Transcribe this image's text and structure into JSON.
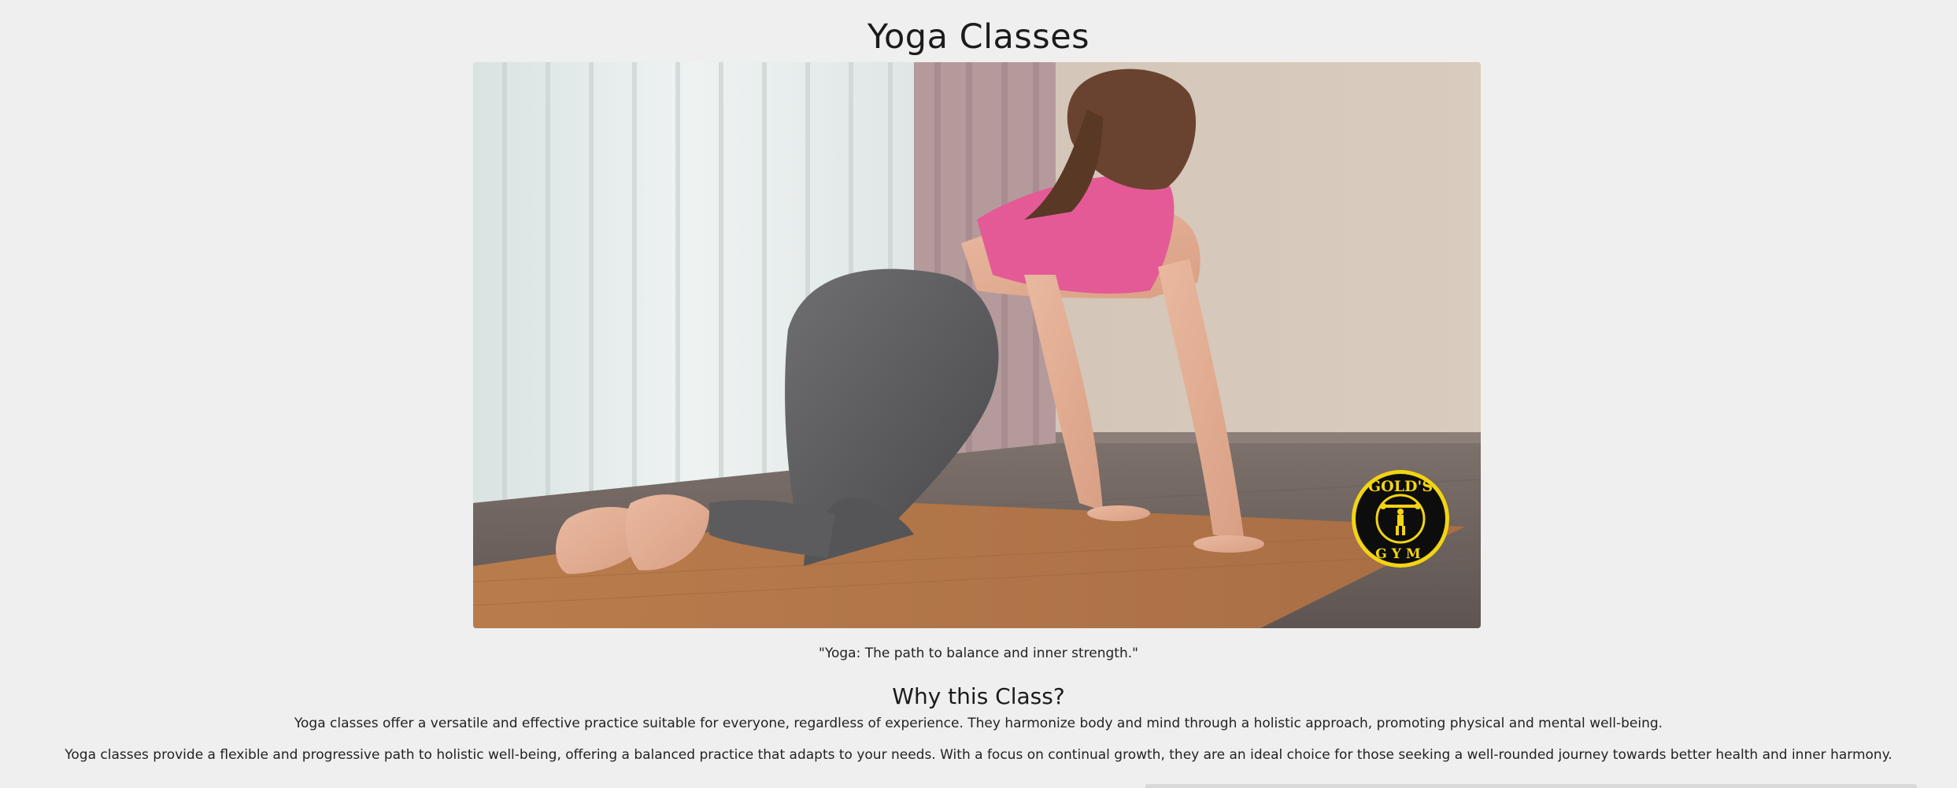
{
  "page": {
    "title": "Yoga Classes",
    "quote": "\"Yoga: The path to balance and inner strength.\"",
    "section_title": "Why this Class?",
    "paragraphs": [
      "Yoga classes offer a versatile and effective practice suitable for everyone, regardless of experience. They harmonize body and mind through a holistic approach, promoting physical and mental well-being.",
      "Yoga classes provide a flexible and progressive path to holistic well-being, offering a balanced practice that adapts to your needs. With a focus on continual growth, they are an ideal choice for those seeking a well-rounded journey towards better health and inner harmony."
    ]
  },
  "hero": {
    "description_icon": "yoga-class-photo"
  },
  "logo": {
    "top_text": "GOLD'S",
    "bottom_text": "GYM",
    "colors": {
      "ring": "#f2d413",
      "fill": "#0d0d0d"
    }
  },
  "colors": {
    "background": "#efefef",
    "text": "#1f1f1f"
  }
}
